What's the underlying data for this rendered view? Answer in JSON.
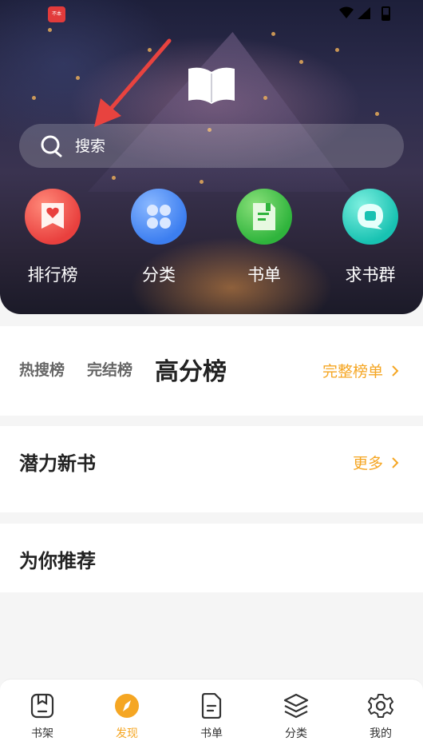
{
  "status_bar": {
    "app_badge_text": "不本"
  },
  "search": {
    "placeholder": "搜索"
  },
  "shortcuts": [
    {
      "label": "排行榜",
      "icon": "ranking-icon",
      "color": "#e9403e"
    },
    {
      "label": "分类",
      "icon": "category-icon",
      "color": "#3c7ef0"
    },
    {
      "label": "书单",
      "icon": "booklist-icon",
      "color": "#2fb43c"
    },
    {
      "label": "求书群",
      "icon": "chat-group-icon",
      "color": "#18c2b2"
    }
  ],
  "ranking": {
    "tabs": [
      "热搜榜",
      "完结榜",
      "高分榜"
    ],
    "active_tab": "高分榜",
    "more_label": "完整榜单"
  },
  "new_books": {
    "title": "潜力新书",
    "more_label": "更多"
  },
  "recommend": {
    "title": "为你推荐"
  },
  "bottom_nav": [
    {
      "label": "书架",
      "icon": "bookshelf-icon"
    },
    {
      "label": "发现",
      "icon": "compass-icon",
      "active": true
    },
    {
      "label": "书单",
      "icon": "document-icon"
    },
    {
      "label": "分类",
      "icon": "layers-icon"
    },
    {
      "label": "我的",
      "icon": "gear-icon"
    }
  ],
  "colors": {
    "accent": "#f5a623",
    "text_dark": "#222222",
    "text_muted": "#666666"
  }
}
